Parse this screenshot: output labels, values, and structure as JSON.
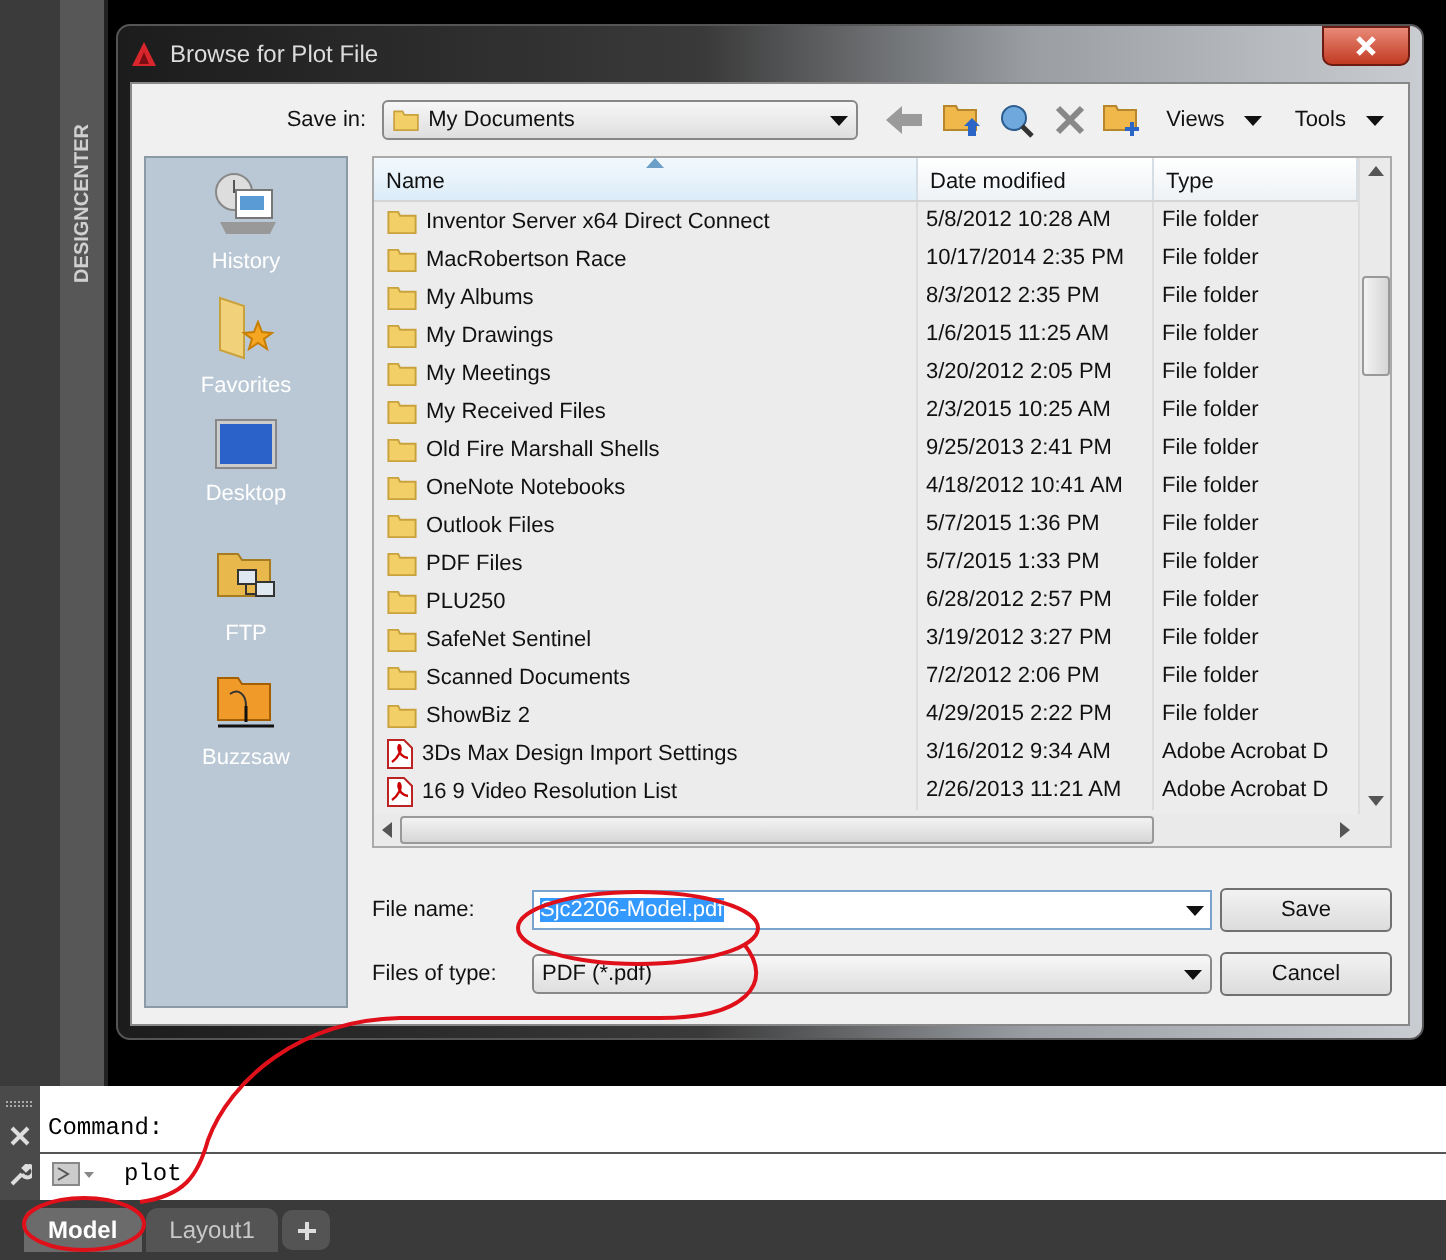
{
  "side_panel": {
    "label": "DESIGNCENTER"
  },
  "dialog": {
    "title": "Browse for Plot File",
    "save_in": {
      "label": "Save in:",
      "value": "My Documents"
    },
    "toolbar": [
      {
        "kind": "back"
      },
      {
        "kind": "up"
      },
      {
        "kind": "web"
      },
      {
        "kind": "delete"
      },
      {
        "kind": "newfolder"
      },
      {
        "kind": "menu",
        "label": "Views"
      },
      {
        "kind": "menu",
        "label": "Tools"
      }
    ],
    "places": [
      {
        "label": "History",
        "kind": "history"
      },
      {
        "label": "Favorites",
        "kind": "favorites"
      },
      {
        "label": "Desktop",
        "kind": "desktop"
      },
      {
        "label": "FTP",
        "kind": "ftp"
      },
      {
        "label": "Buzzsaw",
        "kind": "buzzsaw"
      }
    ],
    "table": {
      "columns": [
        {
          "label": "Name",
          "sorted": true
        },
        {
          "label": "Date modified",
          "sorted": false
        },
        {
          "label": "Type",
          "sorted": false
        }
      ],
      "rows": [
        {
          "kind": "folder",
          "name": "Inventor Server x64 Direct Connect",
          "date": "5/8/2012 10:28 AM",
          "type": "File folder"
        },
        {
          "kind": "folder",
          "name": "MacRobertson Race",
          "date": "10/17/2014 2:35 PM",
          "type": "File folder"
        },
        {
          "kind": "folder",
          "name": "My Albums",
          "date": "8/3/2012 2:35 PM",
          "type": "File folder"
        },
        {
          "kind": "folder",
          "name": "My Drawings",
          "date": "1/6/2015 11:25 AM",
          "type": "File folder"
        },
        {
          "kind": "folder",
          "name": "My Meetings",
          "date": "3/20/2012 2:05 PM",
          "type": "File folder"
        },
        {
          "kind": "folder",
          "name": "My Received Files",
          "date": "2/3/2015 10:25 AM",
          "type": "File folder"
        },
        {
          "kind": "folder",
          "name": "Old Fire Marshall Shells",
          "date": "9/25/2013 2:41 PM",
          "type": "File folder"
        },
        {
          "kind": "folder",
          "name": "OneNote Notebooks",
          "date": "4/18/2012 10:41 AM",
          "type": "File folder"
        },
        {
          "kind": "folder",
          "name": "Outlook Files",
          "date": "5/7/2015 1:36 PM",
          "type": "File folder"
        },
        {
          "kind": "folder",
          "name": "PDF Files",
          "date": "5/7/2015 1:33 PM",
          "type": "File folder"
        },
        {
          "kind": "folder",
          "name": "PLU250",
          "date": "6/28/2012 2:57 PM",
          "type": "File folder"
        },
        {
          "kind": "folder",
          "name": "SafeNet Sentinel",
          "date": "3/19/2012 3:27 PM",
          "type": "File folder"
        },
        {
          "kind": "folder",
          "name": "Scanned Documents",
          "date": "7/2/2012 2:06 PM",
          "type": "File folder"
        },
        {
          "kind": "folder",
          "name": "ShowBiz 2",
          "date": "4/29/2015 2:22 PM",
          "type": "File folder"
        },
        {
          "kind": "pdf",
          "name": "3Ds Max Design Import Settings",
          "date": "3/16/2012 9:34 AM",
          "type": "Adobe Acrobat D"
        },
        {
          "kind": "pdf",
          "name": "16 9 Video Resolution List",
          "date": "2/26/2013 11:21 AM",
          "type": "Adobe Acrobat D"
        }
      ]
    },
    "file_name": {
      "label": "File name:",
      "value": "Sjc2206-Model.pdf"
    },
    "file_type": {
      "label": "Files of type:",
      "value": "PDF (*.pdf)"
    },
    "buttons": [
      "Save",
      "Cancel"
    ]
  },
  "command_line": {
    "history": "Command:",
    "input": "plot"
  },
  "layout_tabs": [
    {
      "label": "Model",
      "selected": true
    },
    {
      "label": "Layout1",
      "selected": false
    }
  ]
}
